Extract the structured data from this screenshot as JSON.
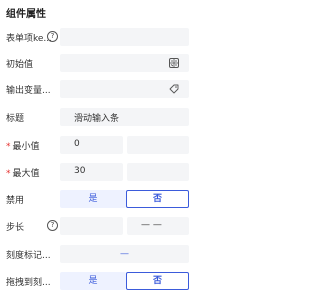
{
  "panel": {
    "title": "组件属性"
  },
  "rows": {
    "form_key": {
      "label": "表单项ke..."
    },
    "initial_value": {
      "label": "初始值"
    },
    "output_var": {
      "label": "输出变量..."
    },
    "title": {
      "label": "标题",
      "value": "滑动输入条"
    },
    "min": {
      "required_mark": "*",
      "label": "最小值",
      "value": "0"
    },
    "max": {
      "required_mark": "*",
      "label": "最大值",
      "value": "30"
    },
    "disabled": {
      "label": "禁用",
      "yes": "是",
      "no": "否"
    },
    "step": {
      "label": "步长",
      "value": "— —"
    },
    "marks": {
      "label": "刻度标记...",
      "value": "—"
    },
    "drag": {
      "label": "拖拽到刻...",
      "yes": "是",
      "no": "否"
    }
  },
  "icons": {
    "help": "?"
  }
}
